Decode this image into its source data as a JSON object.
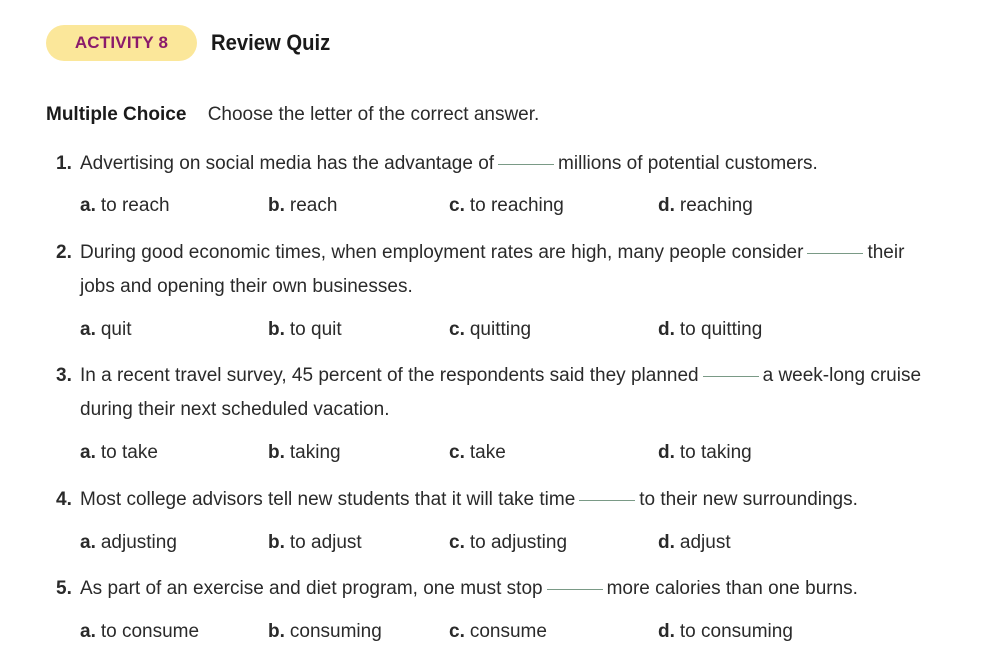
{
  "header": {
    "badge": "ACTIVITY 8",
    "title": "Review Quiz"
  },
  "section": {
    "label": "Multiple Choice",
    "instruction": "Choose the letter of the correct answer."
  },
  "questions": [
    {
      "number": "1.",
      "before": "Advertising on social media has the advantage of",
      "after": "millions of potential customers.",
      "continuation": "",
      "options": [
        {
          "letter": "a.",
          "text": "to reach"
        },
        {
          "letter": "b.",
          "text": "reach"
        },
        {
          "letter": "c.",
          "text": "to reaching"
        },
        {
          "letter": "d.",
          "text": "reaching"
        }
      ]
    },
    {
      "number": "2.",
      "before": "During good economic times, when employment rates are high, many people consider",
      "after": "their",
      "continuation": "jobs and opening their own businesses.",
      "options": [
        {
          "letter": "a.",
          "text": "quit"
        },
        {
          "letter": "b.",
          "text": "to quit"
        },
        {
          "letter": "c.",
          "text": "quitting"
        },
        {
          "letter": "d.",
          "text": "to quitting"
        }
      ]
    },
    {
      "number": "3.",
      "before": "In a recent travel survey, 45 percent of the respondents said they planned",
      "after": "a week-long cruise",
      "continuation": "during their next scheduled vacation.",
      "options": [
        {
          "letter": "a.",
          "text": "to take"
        },
        {
          "letter": "b.",
          "text": "taking"
        },
        {
          "letter": "c.",
          "text": "take"
        },
        {
          "letter": "d.",
          "text": "to taking"
        }
      ]
    },
    {
      "number": "4.",
      "before": "Most college advisors tell new students that it will take time",
      "after": "to their new surroundings.",
      "continuation": "",
      "options": [
        {
          "letter": "a.",
          "text": "adjusting"
        },
        {
          "letter": "b.",
          "text": "to adjust"
        },
        {
          "letter": "c.",
          "text": "to adjusting"
        },
        {
          "letter": "d.",
          "text": "adjust"
        }
      ]
    },
    {
      "number": "5.",
      "before": "As part of an exercise and diet program, one must stop",
      "after": "more calories than one burns.",
      "continuation": "",
      "options": [
        {
          "letter": "a.",
          "text": "to consume"
        },
        {
          "letter": "b.",
          "text": "consuming"
        },
        {
          "letter": "c.",
          "text": "consume"
        },
        {
          "letter": "d.",
          "text": "to consuming"
        }
      ]
    }
  ]
}
